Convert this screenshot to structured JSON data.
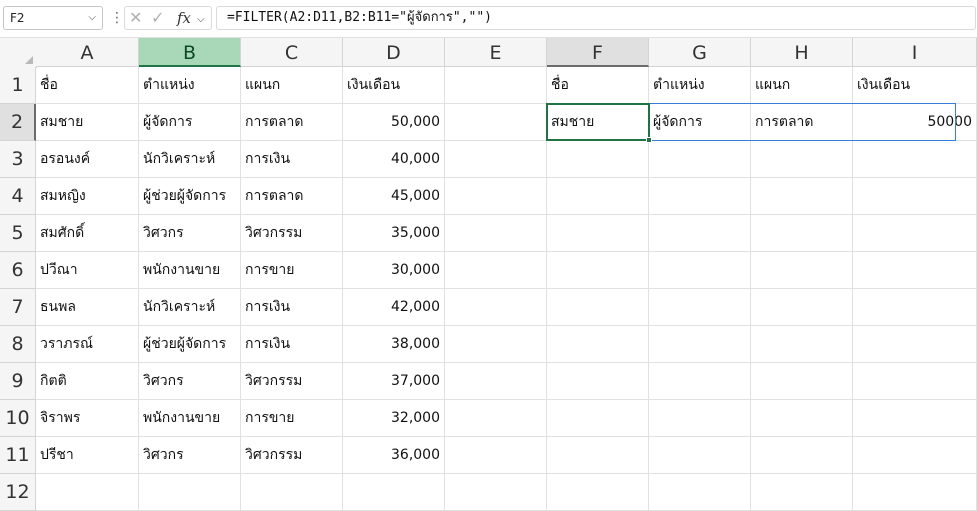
{
  "formula_bar": {
    "name_box": "F2",
    "formula": "=FILTER(A2:D11,B2:B11=\"ผู้จัดการ\",\"\")"
  },
  "icons": {
    "name_box_dropdown": "chevron-down-icon",
    "more": "vertical-dots-icon",
    "cancel": "x-icon",
    "enter": "check-icon",
    "function": "fx-icon",
    "fx_dropdown": "chevron-down-icon"
  },
  "colors": {
    "selection_green": "#217346",
    "spill_blue": "#3c7bd4",
    "selected_header": "#a9d8b8"
  },
  "sheet": {
    "columns": [
      "A",
      "B",
      "C",
      "D",
      "E",
      "F",
      "G",
      "H",
      "I"
    ],
    "rows": [
      "1",
      "2",
      "3",
      "4",
      "5",
      "6",
      "7",
      "8",
      "9",
      "10",
      "11",
      "12"
    ],
    "selected_column": "B",
    "active_cell": "F2",
    "cells": {
      "A1": "ชื่อ",
      "B1": "ตำแหน่ง",
      "C1": "แผนก",
      "D1": "เงินเดือน",
      "F1": "ชื่อ",
      "G1": "ตำแหน่ง",
      "H1": "แผนก",
      "I1": "เงินเดือน",
      "A2": "สมชาย",
      "B2": "ผู้จัดการ",
      "C2": "การตลาด",
      "D2": "50,000",
      "F2": "สมชาย",
      "G2": "ผู้จัดการ",
      "H2": "การตลาด",
      "I2": "50000",
      "A3": "อรอนงค์",
      "B3": "นักวิเคราะห์",
      "C3": "การเงิน",
      "D3": "40,000",
      "A4": "สมหญิง",
      "B4": "ผู้ช่วยผู้จัดการ",
      "C4": "การตลาด",
      "D4": "45,000",
      "A5": "สมศักดิ์",
      "B5": "วิศวกร",
      "C5": "วิศวกรรม",
      "D5": "35,000",
      "A6": "ปวีณา",
      "B6": "พนักงานขาย",
      "C6": "การขาย",
      "D6": "30,000",
      "A7": "ธนพล",
      "B7": "นักวิเคราะห์",
      "C7": "การเงิน",
      "D7": "42,000",
      "A8": "วราภรณ์",
      "B8": "ผู้ช่วยผู้จัดการ",
      "C8": "การเงิน",
      "D8": "38,000",
      "A9": "กิตติ",
      "B9": "วิศวกร",
      "C9": "วิศวกรรม",
      "D9": "37,000",
      "A10": "จิราพร",
      "B10": "พนักงานขาย",
      "C10": "การขาย",
      "D10": "32,000",
      "A11": "ปรีชา",
      "B11": "วิศวกร",
      "C11": "วิศวกรรม",
      "D11": "36,000"
    }
  }
}
